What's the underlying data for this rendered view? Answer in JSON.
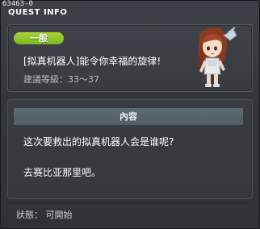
{
  "window": {
    "quest_id": "63463-0",
    "title": "QUEST INFO"
  },
  "quest": {
    "category_badge": "一般",
    "title": "[拟真机器人]能令你幸福的旋律!",
    "level_requirement": "建議等級：33～37",
    "badge_color": "#8fc42a"
  },
  "content": {
    "header": "內容",
    "lines": [
      "这次要救出的拟真机器人会是谁呢?",
      "去赛比亚那里吧。"
    ]
  },
  "status": {
    "text": "狀態： 可開始"
  }
}
